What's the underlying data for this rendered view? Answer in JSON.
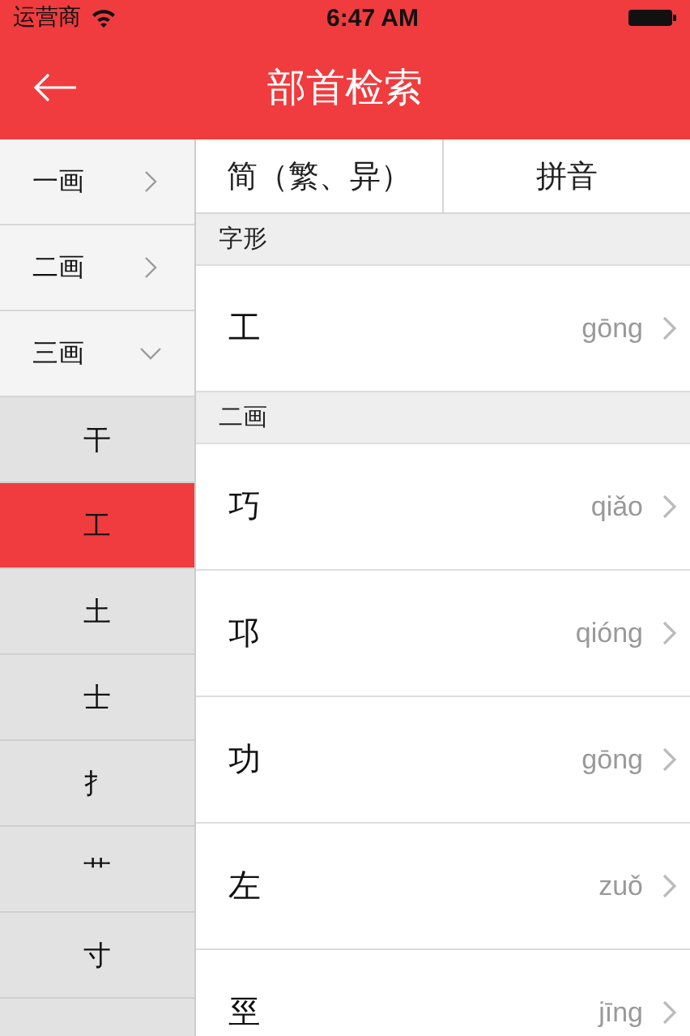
{
  "status_bar": {
    "carrier": "运营商",
    "time": "6:47 AM"
  },
  "nav": {
    "title": "部首检索"
  },
  "stroke_groups": [
    {
      "label": "一画",
      "expanded": false
    },
    {
      "label": "二画",
      "expanded": false
    },
    {
      "label": "三画",
      "expanded": true,
      "children": [
        {
          "label": "干",
          "selected": false
        },
        {
          "label": "工",
          "selected": true
        },
        {
          "label": "土",
          "selected": false
        },
        {
          "label": "士",
          "selected": false
        },
        {
          "label": "扌",
          "selected": false
        },
        {
          "label": "艹",
          "selected": false
        },
        {
          "label": "寸",
          "selected": false
        }
      ]
    }
  ],
  "tabs": [
    {
      "label": "简（繁、异）",
      "selected": false
    },
    {
      "label": "拼音",
      "selected": false
    }
  ],
  "sections": [
    {
      "header": "字形",
      "rows": [
        {
          "char": "工",
          "pinyin": "gōng"
        }
      ]
    },
    {
      "header": "二画",
      "rows": [
        {
          "char": "巧",
          "pinyin": "qiǎo"
        },
        {
          "char": "邛",
          "pinyin": "qióng"
        },
        {
          "char": "功",
          "pinyin": "gōng"
        },
        {
          "char": "左",
          "pinyin": "zuǒ"
        },
        {
          "char": "巠",
          "pinyin": "jīng"
        }
      ]
    }
  ]
}
